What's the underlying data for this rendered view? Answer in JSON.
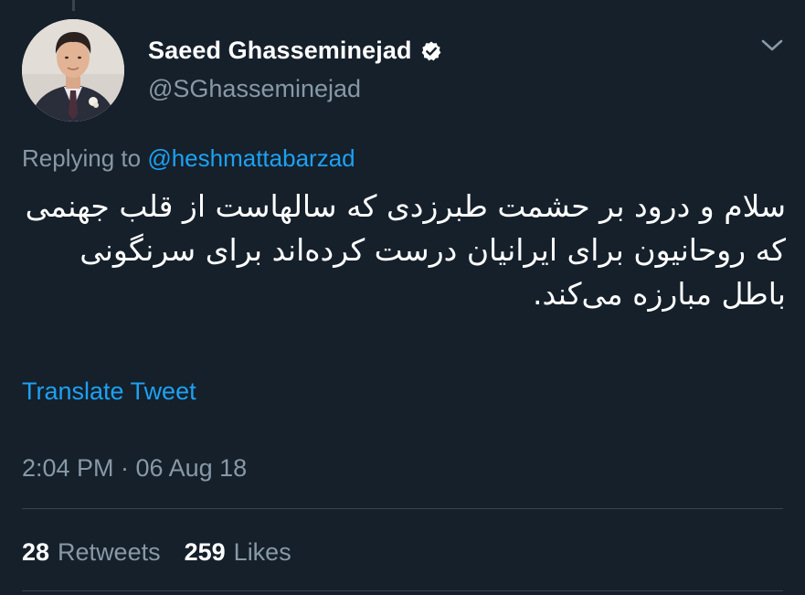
{
  "author": {
    "display_name": "Saeed Ghasseminejad",
    "handle": "@SGhasseminejad",
    "verified": true
  },
  "reply": {
    "prefix": "Replying to",
    "to_handle": "@heshmattabarzad"
  },
  "tweet": {
    "text": "سلام و درود بر حشمت طبرزدی که سالهاست از قلب جهنمی که روحانیون برای ایرانیان درست کرده‌اند برای سرنگونی باطل مبارزه می‌کند.",
    "direction": "rtl"
  },
  "translate_label": "Translate Tweet",
  "timestamp": "2:04 PM · 06 Aug 18",
  "stats": {
    "retweets_count": "28",
    "retweets_label": "Retweets",
    "likes_count": "259",
    "likes_label": "Likes"
  },
  "icons": {
    "verified": "verified-badge-icon",
    "menu": "chevron-down-icon"
  },
  "colors": {
    "background": "#15202b",
    "text_primary": "#ffffff",
    "text_secondary": "#8899a6",
    "accent": "#1da1f2",
    "divider": "#38444d"
  }
}
